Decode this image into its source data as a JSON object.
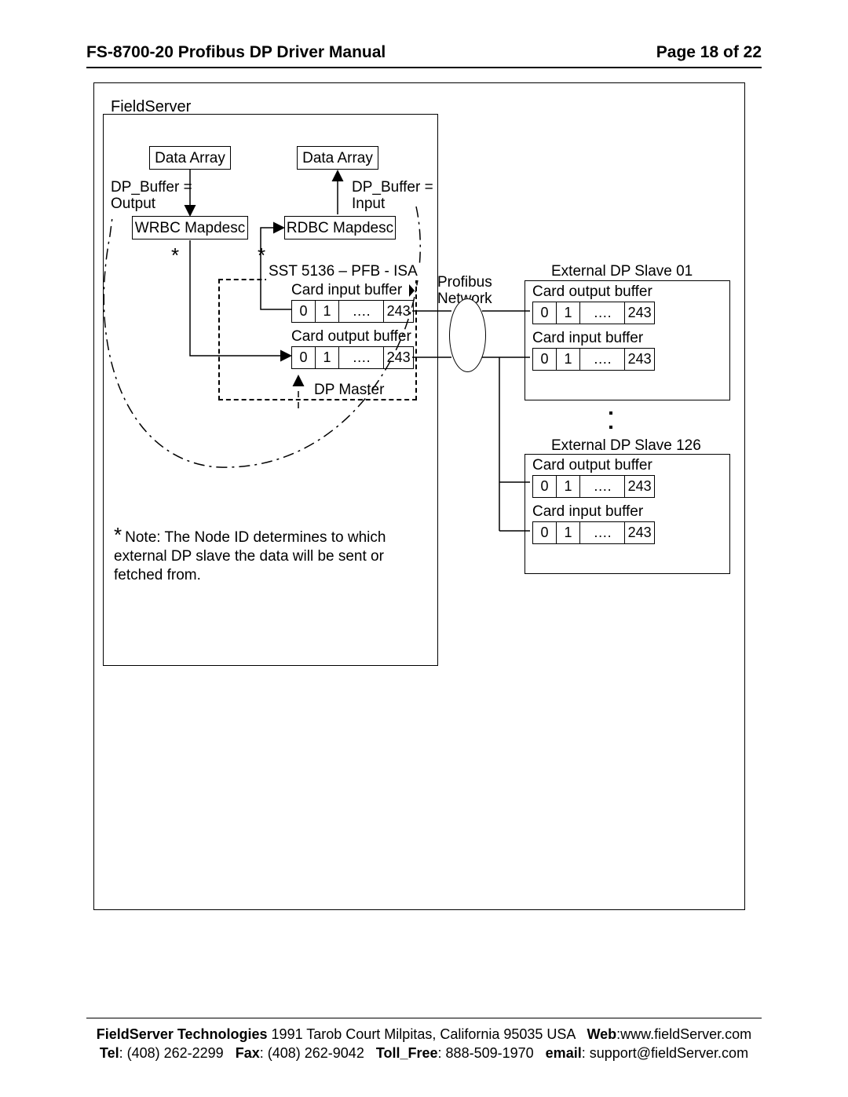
{
  "header": {
    "title": "FS-8700-20 Profibus DP Driver Manual",
    "page": "Page 18 of 22"
  },
  "fieldserver": "FieldServer",
  "da_left": "Data Array",
  "da_right": "Data Array",
  "dpb_out_l1": "DP_Buffer =",
  "dpb_out_l2": "Output",
  "dpb_in_l1": "DP_Buffer =",
  "dpb_in_l2": "Input",
  "wrbc": "WRBC Mapdesc",
  "rdbc": "RDBC Mapdesc",
  "sst": "SST 5136 – PFB - ISA",
  "card_in": "Card input buffer",
  "card_out": "Card output buffer",
  "dp_master": "DP Master",
  "cells": {
    "c0": "0",
    "c1": "1",
    "cd": "….",
    "ce": "243"
  },
  "profibus_l1": "Profibus",
  "profibus_l2": "Network",
  "ext1": "External DP Slave 01",
  "ext126": "External DP Slave 126",
  "note_star": "*",
  "note": "Note:  The Node ID determines to which external DP slave the data will be sent or fetched from.",
  "footer": {
    "company": "FieldServer Technologies",
    "addr": "1991 Tarob Court Milpitas, California 95035 USA",
    "web_lbl": "Web",
    "web": ":www.fieldServer.com",
    "tel_lbl": "Tel",
    "tel": ": (408) 262-2299",
    "fax_lbl": "Fax",
    "fax": ": (408) 262-9042",
    "tf_lbl": "Toll_Free",
    "tf": ": 888-509-1970",
    "em_lbl": "email",
    "em": ": support@fieldServer.com"
  }
}
